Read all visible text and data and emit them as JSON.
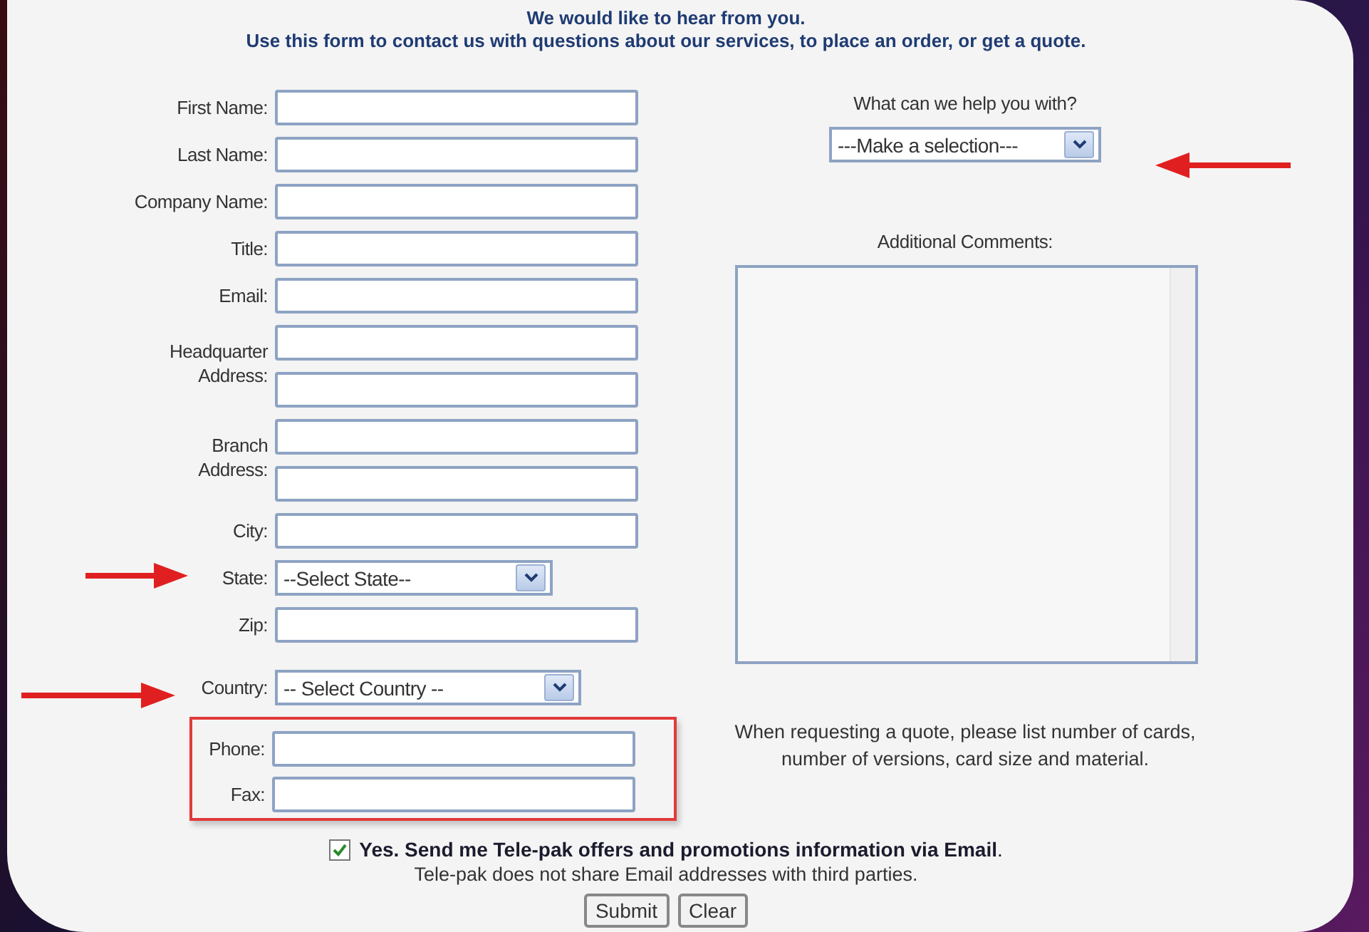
{
  "header": {
    "title": "We would like to hear from you.",
    "subtitle": "Use this form to contact us with questions about our services, to place an order, or get a quote."
  },
  "fields": [
    {
      "kind": "text",
      "label_lines": [
        "First Name:"
      ]
    },
    {
      "kind": "text",
      "label_lines": [
        "Last Name:"
      ]
    },
    {
      "kind": "text",
      "label_lines": [
        "Company Name:"
      ]
    },
    {
      "kind": "text",
      "label_lines": [
        "Title:"
      ]
    },
    {
      "kind": "text",
      "label_lines": [
        "Email:"
      ]
    },
    {
      "kind": "double",
      "label_lines": [
        "Headquarter",
        "Address:"
      ]
    },
    {
      "kind": "double",
      "label_lines": [
        "Branch",
        "Address:"
      ]
    },
    {
      "kind": "text",
      "label_lines": [
        "City:"
      ]
    },
    {
      "kind": "select",
      "label_lines": [
        "State:"
      ],
      "value": "--Select State--"
    },
    {
      "kind": "text",
      "label_lines": [
        "Zip:"
      ]
    },
    {
      "kind": "select",
      "label_lines": [
        "Country:"
      ],
      "value": "-- Select Country --"
    }
  ],
  "highlighted_fields": [
    {
      "label": "Phone:"
    },
    {
      "label": "Fax:"
    }
  ],
  "help": {
    "label": "What can we help you with?",
    "value": "---Make a selection---"
  },
  "comments": {
    "label": "Additional Comments:"
  },
  "quote_note": "When requesting a quote, please list number of cards, number of versions, card size and material.",
  "opt_in": {
    "checked": true,
    "label": "Yes. Send me Tele-pak offers and promotions information via Email",
    "period": ".",
    "note": "Tele-pak does not share Email addresses with third parties."
  },
  "buttons": [
    "Submit",
    "Clear"
  ]
}
